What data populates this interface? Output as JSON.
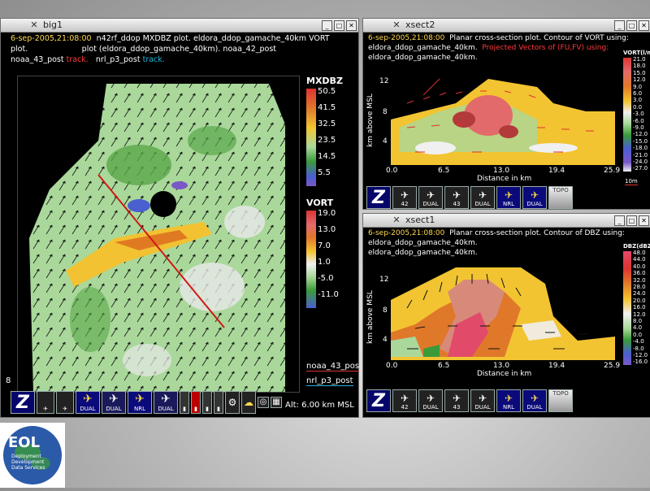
{
  "big1": {
    "title": "big1",
    "header_time": "6-sep-2005,21:08:00",
    "header_line1": "n42rf_ddop MXDBZ  plot.  eldora_ddop_gamache_40km VORT",
    "header_line2a": "plot.",
    "header_line2b": "plot (eldora_ddop_gamache_40km). noaa_42_post",
    "header_line3a": "noaa_43_post",
    "header_track1": "track.",
    "header_line3b": "nrl_p3_post",
    "header_track2": "track.",
    "mxdbz_title": "MXDBZ",
    "mxdbz_ticks": [
      "50.5",
      "41.5",
      "32.5",
      "23.5",
      "14.5",
      "5.5"
    ],
    "vort_title": "VORT",
    "vort_ticks": [
      "19.0",
      "13.0",
      "7.0",
      "1.0",
      "-5.0",
      "-11.0"
    ],
    "legend_noaa43": "noaa_43_pos",
    "legend_nrl": "nrl_p3_post",
    "alt_text": "Alt: 6.00 km MSL",
    "corner_num": "8"
  },
  "xsect2": {
    "title": "xsect2",
    "header_time": "6-sep-2005,21:08:00",
    "header_rest": "Planar cross-section plot.  Contour of VORT using:",
    "header_line2a": "eldora_ddop_gamache_40km.",
    "header_line2b": "Projected Vectors of (FU,FV) using:",
    "header_line3": "eldora_ddop_gamache_40km.",
    "cbar_title": "VORT(l/m",
    "cbar_ticks": [
      "21.0",
      "18.0",
      "15.0",
      "12.0",
      "9.0",
      "6.0",
      "3.0",
      "0.0",
      "-3.0",
      "-6.0",
      "-9.0",
      "-12.0",
      "-15.0",
      "-18.0",
      "-21.0",
      "-24.0",
      "-27.0"
    ],
    "y_ticks": [
      "12",
      "8",
      "4"
    ],
    "x_ticks": [
      "0.0",
      "6.5",
      "13.0",
      "19.4",
      "25.9"
    ],
    "ylabel": "km above MSL",
    "xlabel": "Distance in km",
    "scale_label": "10m"
  },
  "xsect1": {
    "title": "xsect1",
    "header_time": "6-sep-2005,21:08:00",
    "header_rest": "Planar cross-section plot.  Contour of DBZ using:",
    "header_line2": "eldora_ddop_gamache_40km.",
    "header_line3": "eldora_ddop_gamache_40km.",
    "cbar_title": "DBZ(dBZ",
    "cbar_ticks": [
      "48.0",
      "44.0",
      "40.0",
      "36.0",
      "32.0",
      "28.0",
      "24.0",
      "20.0",
      "16.0",
      "12.0",
      "8.0",
      "4.0",
      "0.0",
      "-4.0",
      "-8.0",
      "-12.0",
      "-16.0"
    ],
    "y_ticks": [
      "12",
      "8",
      "4"
    ],
    "x_ticks": [
      "0.0",
      "6.5",
      "13.0",
      "19.4",
      "25.9"
    ],
    "ylabel": "km above MSL",
    "xlabel": "Distance in km"
  },
  "toolbar": {
    "z": "Z",
    "n42_label": "42",
    "dual": "DUAL",
    "n43_label": "43",
    "nrl": "NRL",
    "topo": "TOPO"
  },
  "logo": {
    "title": "EOL",
    "line1": "Deployment",
    "line2": "Development",
    "line3": "Data Services"
  }
}
